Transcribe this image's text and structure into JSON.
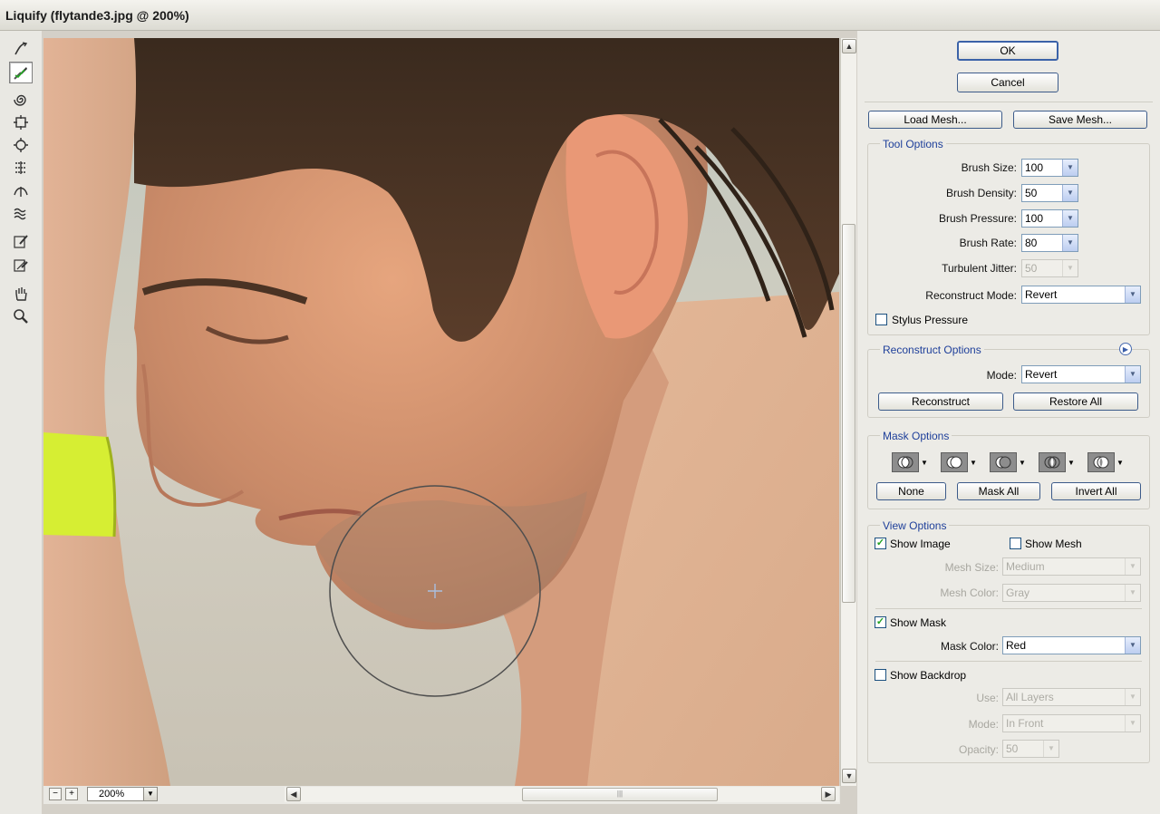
{
  "window": {
    "title": "Liquify (flytande3.jpg @ 200%)"
  },
  "tools": [
    {
      "name": "forward-warp-tool-icon"
    },
    {
      "name": "reconstruct-tool-icon"
    },
    {
      "name": "twirl-clockwise-tool-icon"
    },
    {
      "name": "pucker-tool-icon"
    },
    {
      "name": "bloat-tool-icon"
    },
    {
      "name": "push-left-tool-icon"
    },
    {
      "name": "mirror-tool-icon"
    },
    {
      "name": "turbulence-tool-icon"
    },
    {
      "name": "freeze-mask-tool-icon"
    },
    {
      "name": "thaw-mask-tool-icon"
    },
    {
      "name": "hand-tool-icon"
    },
    {
      "name": "zoom-tool-icon"
    }
  ],
  "statusbar": {
    "zoom": "200%",
    "zoom_out": "−",
    "zoom_in": "+"
  },
  "buttons": {
    "ok": "OK",
    "cancel": "Cancel",
    "load_mesh": "Load Mesh...",
    "save_mesh": "Save Mesh..."
  },
  "tool_options": {
    "title": "Tool Options",
    "brush_size_label": "Brush Size:",
    "brush_size": "100",
    "brush_density_label": "Brush Density:",
    "brush_density": "50",
    "brush_pressure_label": "Brush Pressure:",
    "brush_pressure": "100",
    "brush_rate_label": "Brush Rate:",
    "brush_rate": "80",
    "turbulent_jitter_label": "Turbulent Jitter:",
    "turbulent_jitter": "50",
    "reconstruct_mode_label": "Reconstruct Mode:",
    "reconstruct_mode": "Revert",
    "stylus_pressure_label": "Stylus Pressure",
    "stylus_pressure_checked": false
  },
  "reconstruct_options": {
    "title": "Reconstruct Options",
    "mode_label": "Mode:",
    "mode": "Revert",
    "reconstruct_button": "Reconstruct",
    "restore_all_button": "Restore All"
  },
  "mask_options": {
    "title": "Mask Options",
    "icons": [
      "replace-selection-icon",
      "add-to-selection-icon",
      "subtract-from-selection-icon",
      "intersect-with-selection-icon",
      "invert-selection-icon"
    ],
    "none_button": "None",
    "mask_all_button": "Mask All",
    "invert_all_button": "Invert All"
  },
  "view_options": {
    "title": "View Options",
    "show_image_label": "Show Image",
    "show_image_checked": true,
    "show_mesh_label": "Show Mesh",
    "show_mesh_checked": false,
    "mesh_size_label": "Mesh Size:",
    "mesh_size": "Medium",
    "mesh_color_label": "Mesh Color:",
    "mesh_color": "Gray",
    "show_mask_label": "Show Mask",
    "show_mask_checked": true,
    "mask_color_label": "Mask Color:",
    "mask_color": "Red",
    "show_backdrop_label": "Show Backdrop",
    "show_backdrop_checked": false,
    "use_label": "Use:",
    "use": "All Layers",
    "mode_label": "Mode:",
    "mode": "In Front",
    "opacity_label": "Opacity:",
    "opacity": "50"
  },
  "colors": {
    "group_title": "#1e3f9a",
    "button_border": "#3c5b8a",
    "check_mark": "#21a121"
  }
}
